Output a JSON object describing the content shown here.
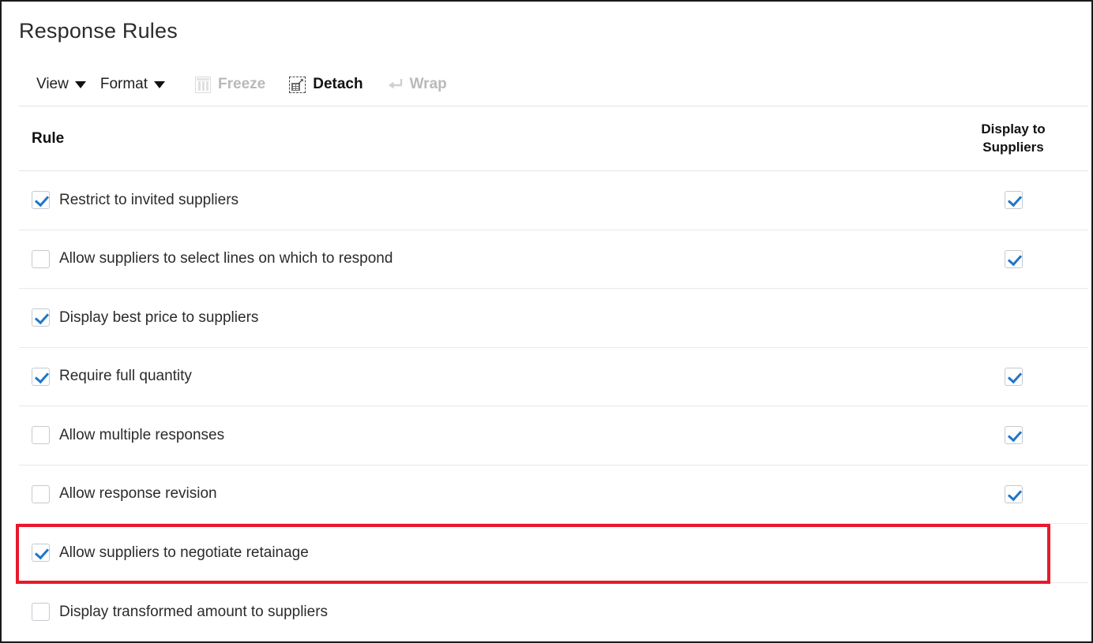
{
  "page": {
    "title": "Response Rules"
  },
  "toolbar": {
    "view_label": "View",
    "format_label": "Format",
    "freeze_label": "Freeze",
    "detach_label": "Detach",
    "wrap_label": "Wrap",
    "freeze_icon": "freeze-icon",
    "detach_icon": "detach-icon",
    "wrap_icon": "wrap-icon",
    "view_caret_icon": "chevron-down-icon",
    "format_caret_icon": "chevron-down-icon"
  },
  "table": {
    "columns": [
      {
        "key": "rule",
        "label": "Rule"
      },
      {
        "key": "display_to_suppliers",
        "label": "Display to\nSuppliers",
        "line1": "Display to",
        "line2": "Suppliers"
      }
    ],
    "rows": [
      {
        "rule": "Restrict to invited suppliers",
        "rule_checked": true,
        "display_present": true,
        "display_checked": true,
        "highlighted": false
      },
      {
        "rule": "Allow suppliers to select lines on which to respond",
        "rule_checked": false,
        "display_present": true,
        "display_checked": true,
        "highlighted": false
      },
      {
        "rule": "Display best price to suppliers",
        "rule_checked": true,
        "display_present": false,
        "display_checked": false,
        "highlighted": false
      },
      {
        "rule": "Require full quantity",
        "rule_checked": true,
        "display_present": true,
        "display_checked": true,
        "highlighted": false
      },
      {
        "rule": "Allow multiple responses",
        "rule_checked": false,
        "display_present": true,
        "display_checked": true,
        "highlighted": false
      },
      {
        "rule": "Allow response revision",
        "rule_checked": false,
        "display_present": true,
        "display_checked": true,
        "highlighted": false
      },
      {
        "rule": "Allow suppliers to negotiate retainage",
        "rule_checked": true,
        "display_present": false,
        "display_checked": false,
        "highlighted": true
      },
      {
        "rule": "Display transformed amount to suppliers",
        "rule_checked": false,
        "display_present": false,
        "display_checked": false,
        "highlighted": false
      }
    ]
  },
  "colors": {
    "checkbox_accent": "#1f76c8",
    "highlight_border": "#e8192c",
    "page_border": "#1a1a1a",
    "row_divider": "#e6e9ec",
    "disabled_text": "#b9b9b9"
  }
}
